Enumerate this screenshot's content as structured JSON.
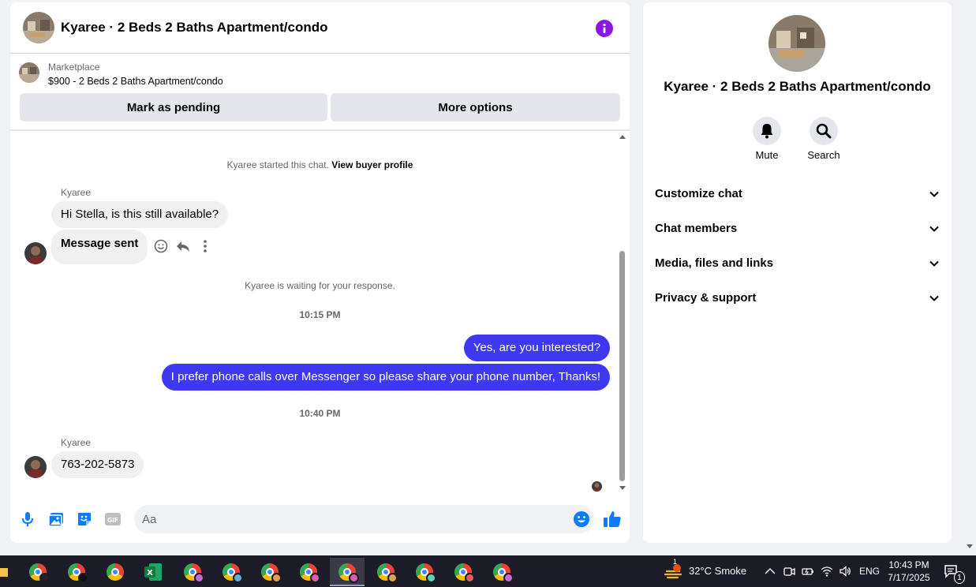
{
  "header": {
    "title": "Kyaree · 2 Beds 2 Baths Apartment/condo"
  },
  "marketplace": {
    "label": "Marketplace",
    "listing": "$900 - 2 Beds 2 Baths Apartment/condo",
    "pending_label": "Mark as pending",
    "more_label": "More options"
  },
  "messages": {
    "started_text": "Kyaree started this chat.",
    "buyer_profile_link": "View buyer profile",
    "sender_1": "Kyaree",
    "msg_1": "Hi Stella, is this still available?",
    "msg_2": "Message sent",
    "waiting_text": "Kyaree is waiting for your response.",
    "time_1": "10:15 PM",
    "reply_1": "Yes, are you interested?",
    "reply_2": "I prefer phone calls over Messenger so please share your phone number, Thanks!",
    "time_2": "10:40 PM",
    "sender_2": "Kyaree",
    "msg_3": "763-202-5873"
  },
  "composer": {
    "placeholder": "Aa"
  },
  "info_panel": {
    "title": "Kyaree · 2 Beds 2 Baths Apartment/condo",
    "mute_label": "Mute",
    "search_label": "Search",
    "sections": [
      "Customize chat",
      "Chat members",
      "Media, files and links",
      "Privacy & support"
    ]
  },
  "taskbar": {
    "weather_badge": "1",
    "weather": "32°C  Smoke",
    "language": "ENG",
    "time": "10:43 PM",
    "date": "7/17/2025",
    "notification_count": "1"
  },
  "colors": {
    "accent": "#3e39f0",
    "icon_blue": "#0a7cff",
    "info_purple": "#8a16e7"
  }
}
